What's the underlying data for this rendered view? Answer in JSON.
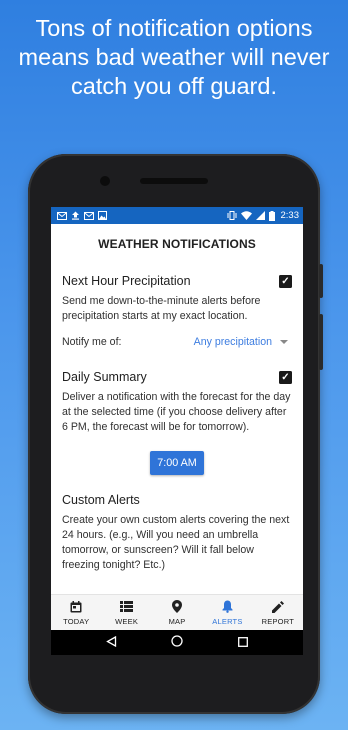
{
  "headline": {
    "line1": "Tons of notification options",
    "line2": "means bad weather will never",
    "line3": "catch you off guard."
  },
  "status_bar": {
    "time": "2:33",
    "left_icons": [
      "mail-icon",
      "upload-icon",
      "mail-icon",
      "image-icon"
    ],
    "right_icons": [
      "vibrate-icon",
      "wifi-icon",
      "signal-icon",
      "battery-icon"
    ]
  },
  "screen": {
    "title": "WEATHER NOTIFICATIONS",
    "next_hour": {
      "title": "Next Hour Precipitation",
      "checked": true,
      "description": "Send me down-to-the-minute alerts before precipitation starts at my exact location.",
      "notify_label": "Notify me of:",
      "notify_value": "Any precipitation"
    },
    "daily_summary": {
      "title": "Daily Summary",
      "checked": true,
      "description": "Deliver a notification with the forecast for the day at the selected time (if you choose delivery after 6 PM, the forecast will be for tomorrow).",
      "time_button": "7:00 AM"
    },
    "custom_alerts": {
      "title": "Custom Alerts",
      "description": "Create your own custom alerts covering the next 24 hours. (e.g., Will you need an umbrella tomorrow, or sunscreen? Will it fall below freezing tonight? Etc.)"
    }
  },
  "bottom_nav": {
    "items": [
      {
        "label": "TODAY",
        "icon": "calendar-icon"
      },
      {
        "label": "WEEK",
        "icon": "list-icon"
      },
      {
        "label": "MAP",
        "icon": "map-pin-icon"
      },
      {
        "label": "ALERTS",
        "icon": "bell-icon"
      },
      {
        "label": "REPORT",
        "icon": "pencil-icon"
      }
    ],
    "active": "ALERTS"
  },
  "colors": {
    "accent": "#2f74d8",
    "status_bar": "#1565c0",
    "background_top": "#2f7fe0",
    "background_bottom": "#6cb3f3"
  }
}
